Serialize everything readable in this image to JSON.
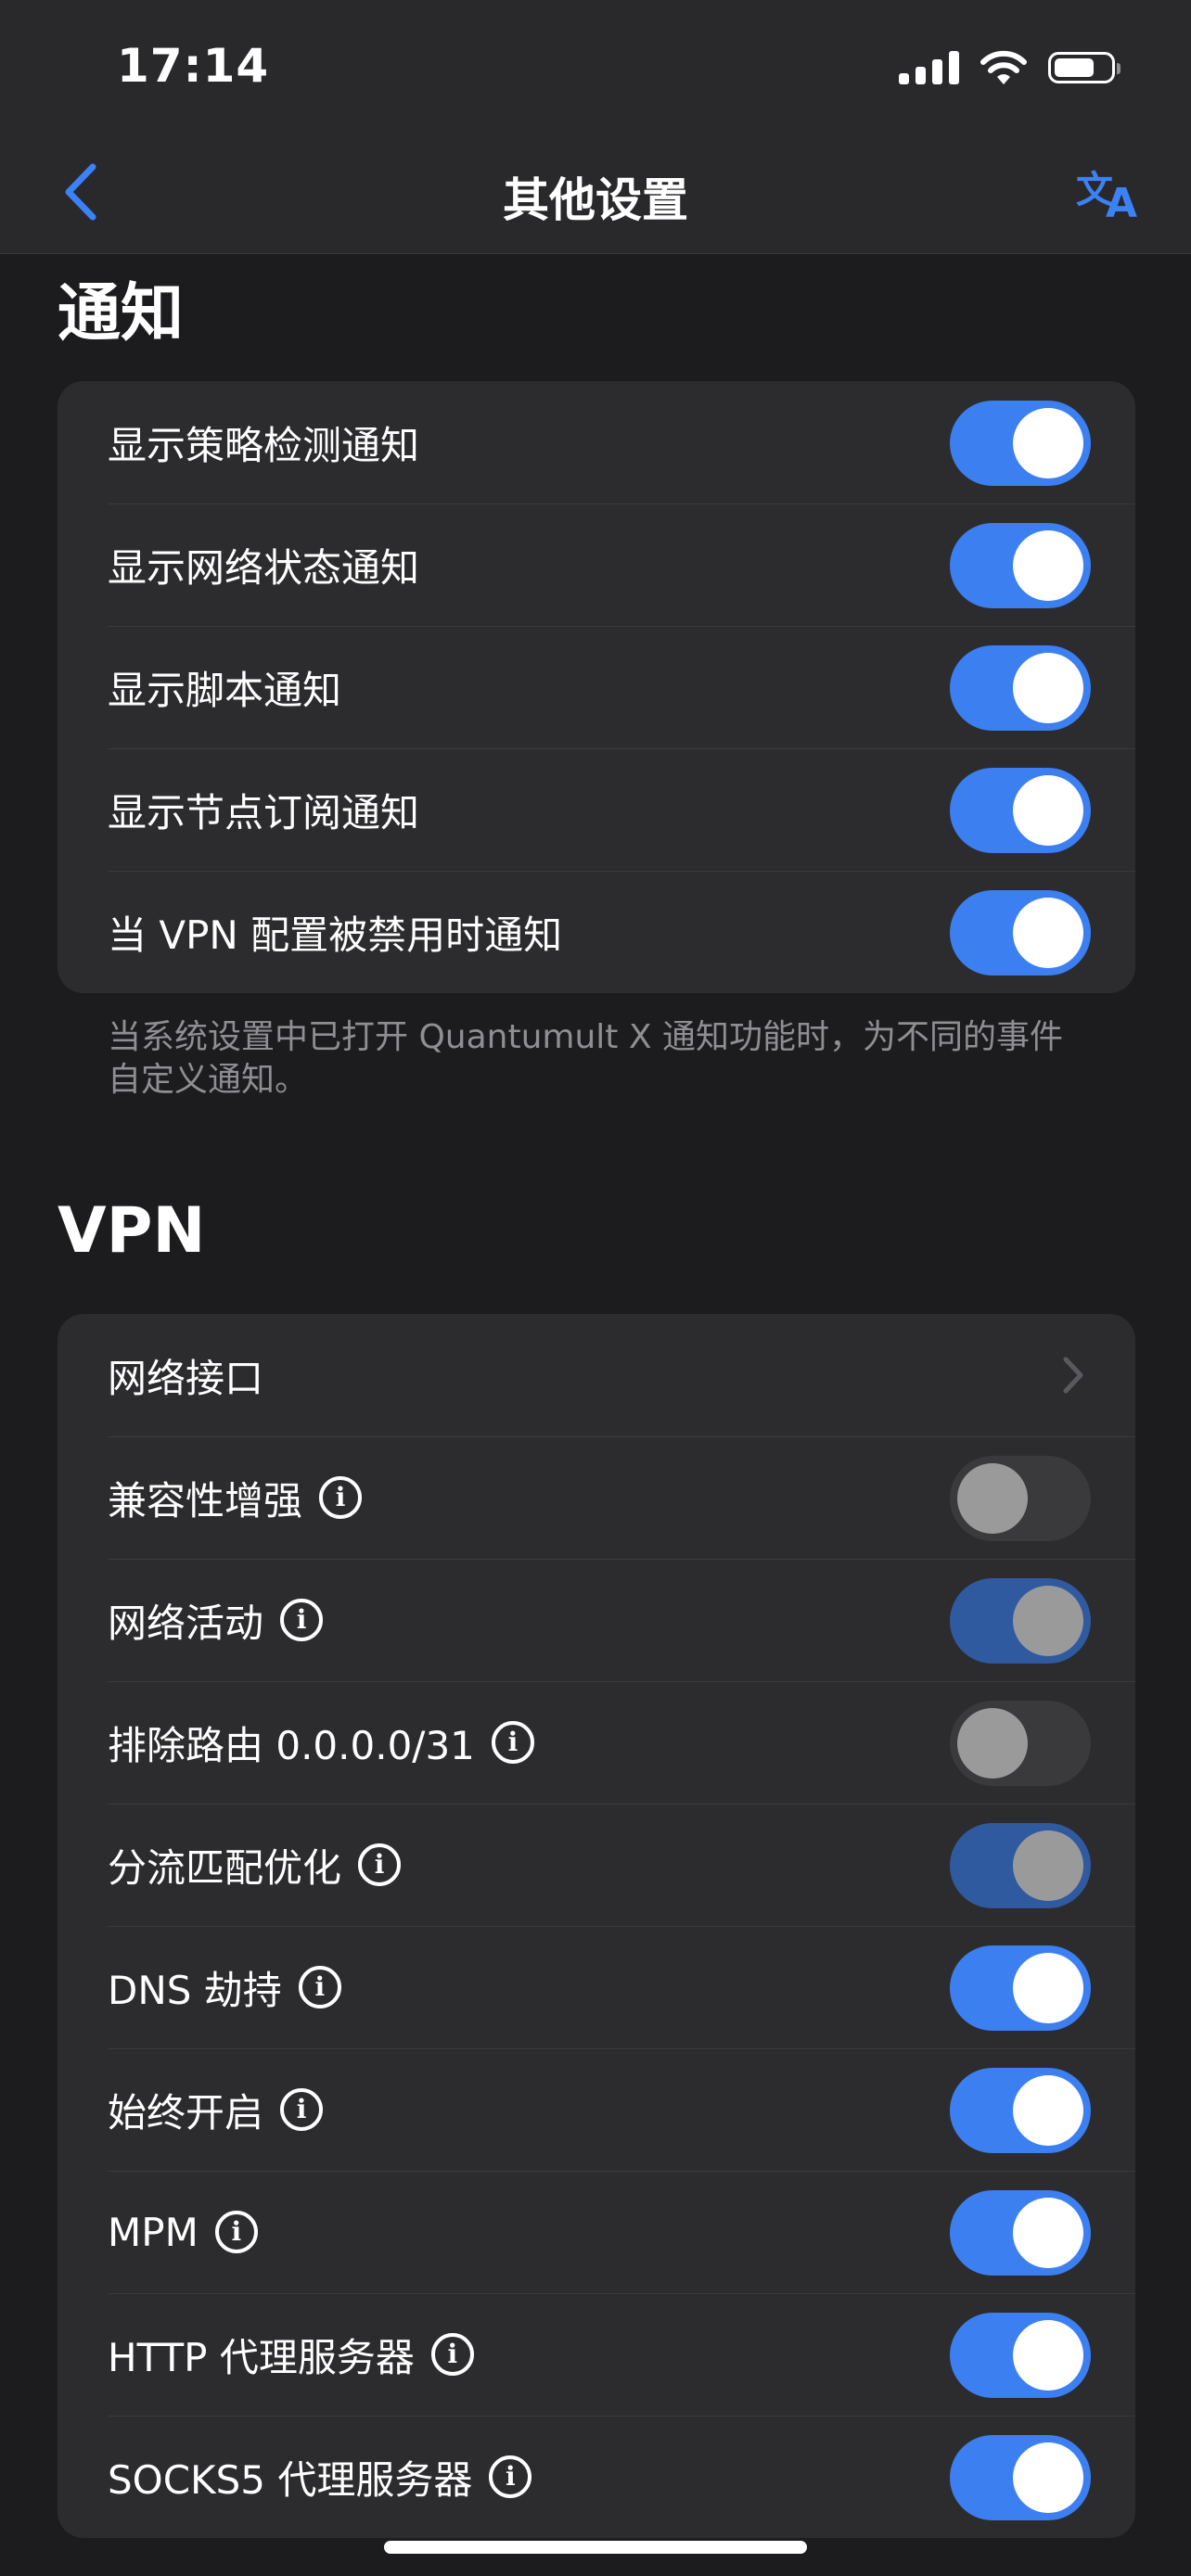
{
  "status_bar": {
    "time": "17:14"
  },
  "nav": {
    "title": "其他设置"
  },
  "sections": [
    {
      "title": "通知",
      "rows": [
        {
          "label": "显示策略检测通知",
          "toggle": "on"
        },
        {
          "label": "显示网络状态通知",
          "toggle": "on"
        },
        {
          "label": "显示脚本通知",
          "toggle": "on"
        },
        {
          "label": "显示节点订阅通知",
          "toggle": "on"
        },
        {
          "label": "当 VPN 配置被禁用时通知",
          "toggle": "on"
        }
      ],
      "footnote": "当系统设置中已打开 Quantumult X 通知功能时，为不同的事件自定义通知。"
    },
    {
      "title": "VPN",
      "rows": [
        {
          "label": "网络接口",
          "chevron": true
        },
        {
          "label": "兼容性增强",
          "info": true,
          "toggle": "off"
        },
        {
          "label": "网络活动",
          "info": true,
          "toggle": "on-disabled"
        },
        {
          "label": "排除路由 0.0.0.0/31",
          "info": true,
          "toggle": "off"
        },
        {
          "label": "分流匹配优化",
          "info": true,
          "toggle": "on-disabled"
        },
        {
          "label": "DNS 劫持",
          "info": true,
          "toggle": "on"
        },
        {
          "label": "始终开启",
          "info": true,
          "toggle": "on"
        },
        {
          "label": "MPM",
          "info": true,
          "toggle": "on"
        },
        {
          "label": "HTTP 代理服务器",
          "info": true,
          "toggle": "on"
        },
        {
          "label": "SOCKS5 代理服务器",
          "info": true,
          "toggle": "on"
        }
      ]
    }
  ],
  "icons": {
    "back": "chevron-left-icon",
    "translate": "translate-icon",
    "info": "info-icon",
    "disclosure": "chevron-right-icon"
  },
  "colors": {
    "accent": "#3b7ff0",
    "background": "#1c1c1e",
    "card": "#2c2c2e",
    "secondary_text": "#8e8e93"
  }
}
